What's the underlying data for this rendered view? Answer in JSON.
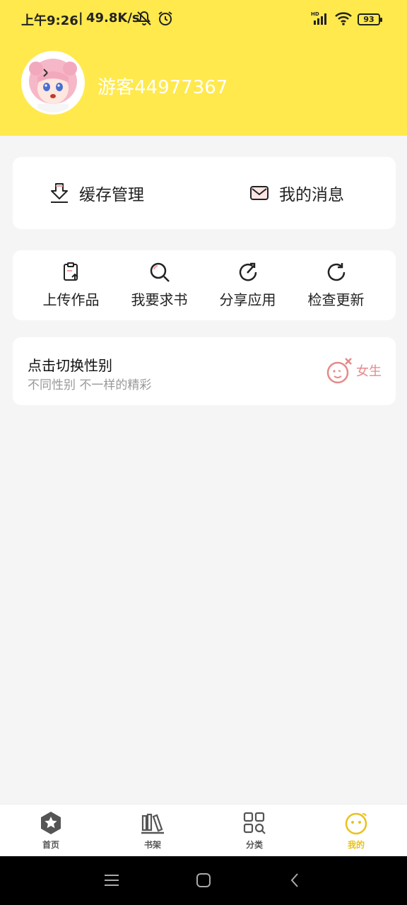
{
  "status": {
    "time": "上午9:26",
    "separator": "|",
    "speed": "49.8K/s",
    "icons": [
      "mute-icon",
      "alarm-icon",
      "hd-signal-icon",
      "wifi-icon"
    ],
    "battery": "93"
  },
  "profile": {
    "username": "游客44977367",
    "avatar": "anime-avatar"
  },
  "quick_actions": [
    {
      "label": "缓存管理",
      "icon": "download-icon"
    },
    {
      "label": "我的消息",
      "icon": "mail-icon"
    }
  ],
  "tools": [
    {
      "label": "上传作品",
      "icon": "upload-clipboard-icon"
    },
    {
      "label": "我要求书",
      "icon": "search-icon"
    },
    {
      "label": "分享应用",
      "icon": "share-icon"
    },
    {
      "label": "检查更新",
      "icon": "refresh-icon"
    }
  ],
  "gender": {
    "title": "点击切换性别",
    "subtitle": "不同性别 不一样的精彩",
    "current": "女生",
    "icon": "female-face-icon"
  },
  "tabs": [
    {
      "label": "首页",
      "icon": "star-hexagon-icon",
      "active": false
    },
    {
      "label": "书架",
      "icon": "bookshelf-icon",
      "active": false
    },
    {
      "label": "分类",
      "icon": "category-grid-icon",
      "active": false
    },
    {
      "label": "我的",
      "icon": "smiley-face-icon",
      "active": true
    }
  ],
  "colors": {
    "header_bg": "#ffe94d",
    "accent": "#e8c21c",
    "female": "#e58a8a",
    "background": "#f5f5f5"
  }
}
